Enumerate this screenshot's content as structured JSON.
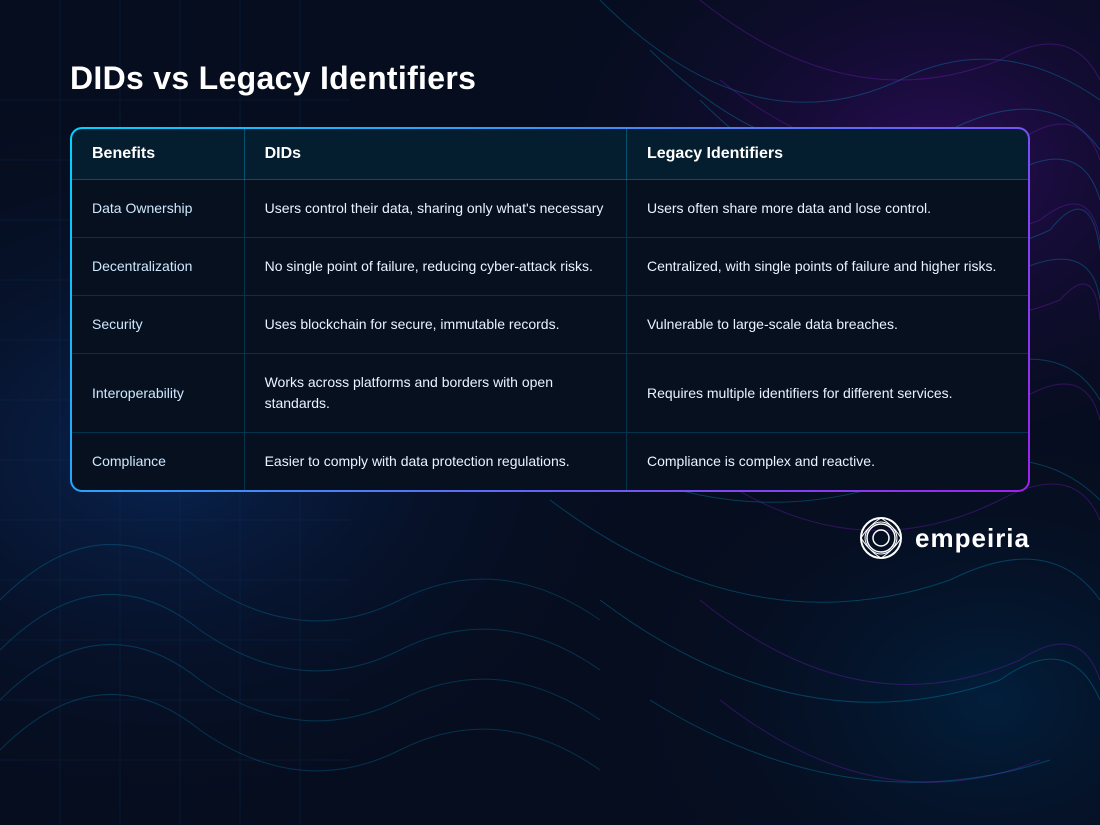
{
  "page": {
    "title": "DIDs vs Legacy Identifiers"
  },
  "table": {
    "headers": [
      "Benefits",
      "DIDs",
      "Legacy Identifiers"
    ],
    "rows": [
      {
        "benefit": "Data Ownership",
        "dids": "Users control their data, sharing only what's necessary",
        "legacy": "Users often share more data and lose control."
      },
      {
        "benefit": "Decentralization",
        "dids": "No single point of failure, reducing cyber-attack risks.",
        "legacy": "Centralized, with single points of failure and higher risks."
      },
      {
        "benefit": "Security",
        "dids": "Uses blockchain for secure, immutable records.",
        "legacy": "Vulnerable to large-scale data breaches."
      },
      {
        "benefit": "Interoperability",
        "dids": "Works across platforms and borders with open standards.",
        "legacy": "Requires multiple identifiers for different services."
      },
      {
        "benefit": "Compliance",
        "dids": "Easier to comply with data protection regulations.",
        "legacy": "Compliance is complex and reactive."
      }
    ]
  },
  "brand": {
    "name": "empeiria"
  }
}
